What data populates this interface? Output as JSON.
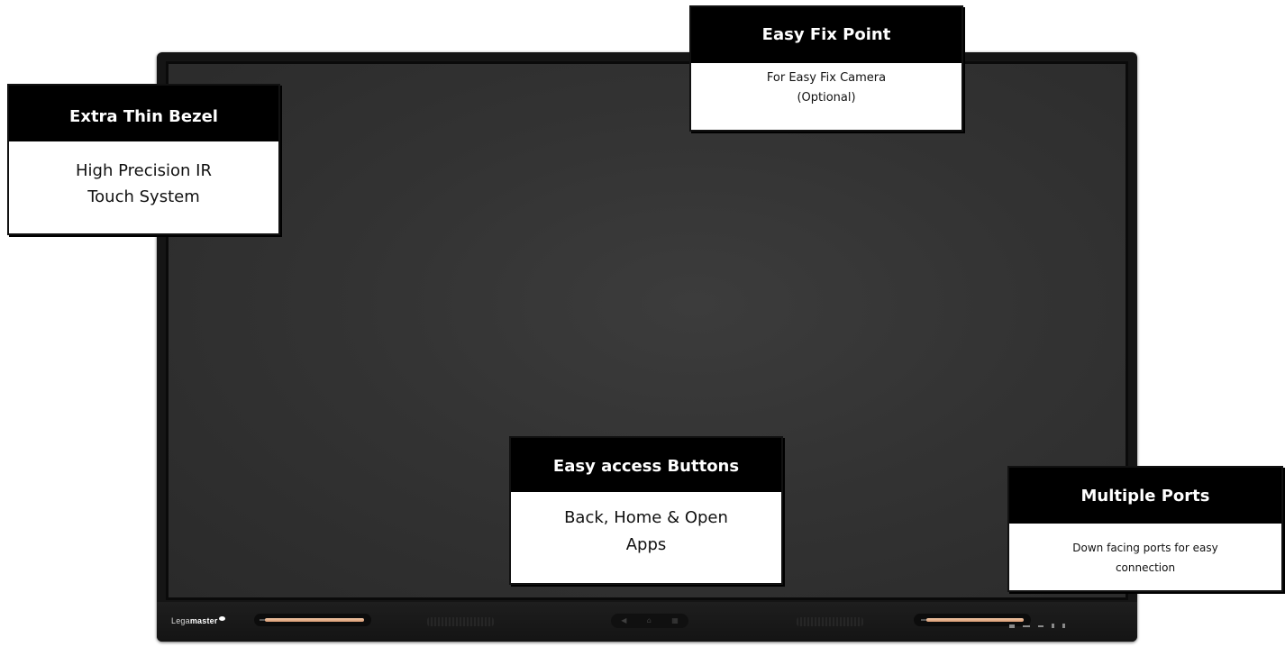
{
  "brand": {
    "prefix": "Lega",
    "name": "master"
  },
  "nav_buttons": {
    "back": "◀",
    "home": "⌂",
    "apps": "▦"
  },
  "callouts": {
    "bezel": {
      "title": "Extra Thin Bezel",
      "line1": "High Precision IR",
      "line2": "Touch System"
    },
    "fix": {
      "title": "Easy Fix Point",
      "line1": "For Easy Fix Camera",
      "line2": "(Optional)"
    },
    "buttons": {
      "title": "Easy access Buttons",
      "line1": "Back, Home & Open",
      "line2": "Apps"
    },
    "ports": {
      "title": "Multiple Ports",
      "line1": "Down facing ports for easy",
      "line2": "connection"
    }
  },
  "colors": {
    "callout_header": "#000000",
    "callout_body": "#ffffff",
    "bezel": "#151515",
    "screen": "#333333",
    "pen": "#e0ad88"
  }
}
